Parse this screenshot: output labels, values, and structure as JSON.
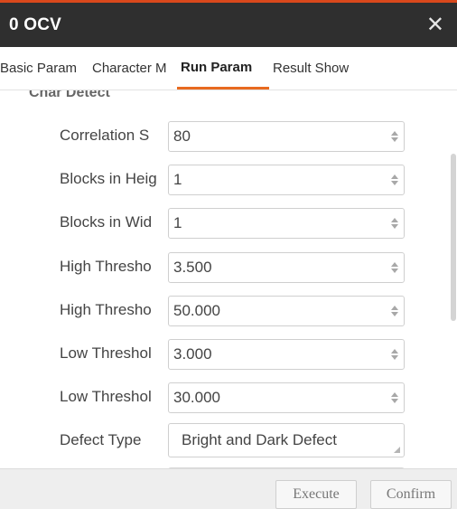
{
  "window": {
    "title": "0 OCV",
    "close_glyph": "✕"
  },
  "tabs": [
    {
      "label": "Basic Param"
    },
    {
      "label": "Character M"
    },
    {
      "label": "Run Param",
      "active": true
    },
    {
      "label": "Result Show"
    }
  ],
  "section": {
    "header": "Char Detect"
  },
  "params": [
    {
      "label": "Correlation S",
      "value": "80"
    },
    {
      "label": "Blocks in Heig",
      "value": "1"
    },
    {
      "label": "Blocks in Wid",
      "value": "1"
    },
    {
      "label": "High Thresho",
      "value": "3.500"
    },
    {
      "label": "High Thresho",
      "value": "50.000"
    },
    {
      "label": "Low Threshol",
      "value": "3.000"
    },
    {
      "label": "Low Threshol",
      "value": "30.000"
    }
  ],
  "defect_type": {
    "label": "Defect Type",
    "value": "Bright and Dark Defect"
  },
  "footer": {
    "execute_label": "Execute",
    "confirm_label": "Confirm"
  },
  "colors": {
    "titlebar": "#2f2f2f",
    "accent": "#e86a1f"
  }
}
